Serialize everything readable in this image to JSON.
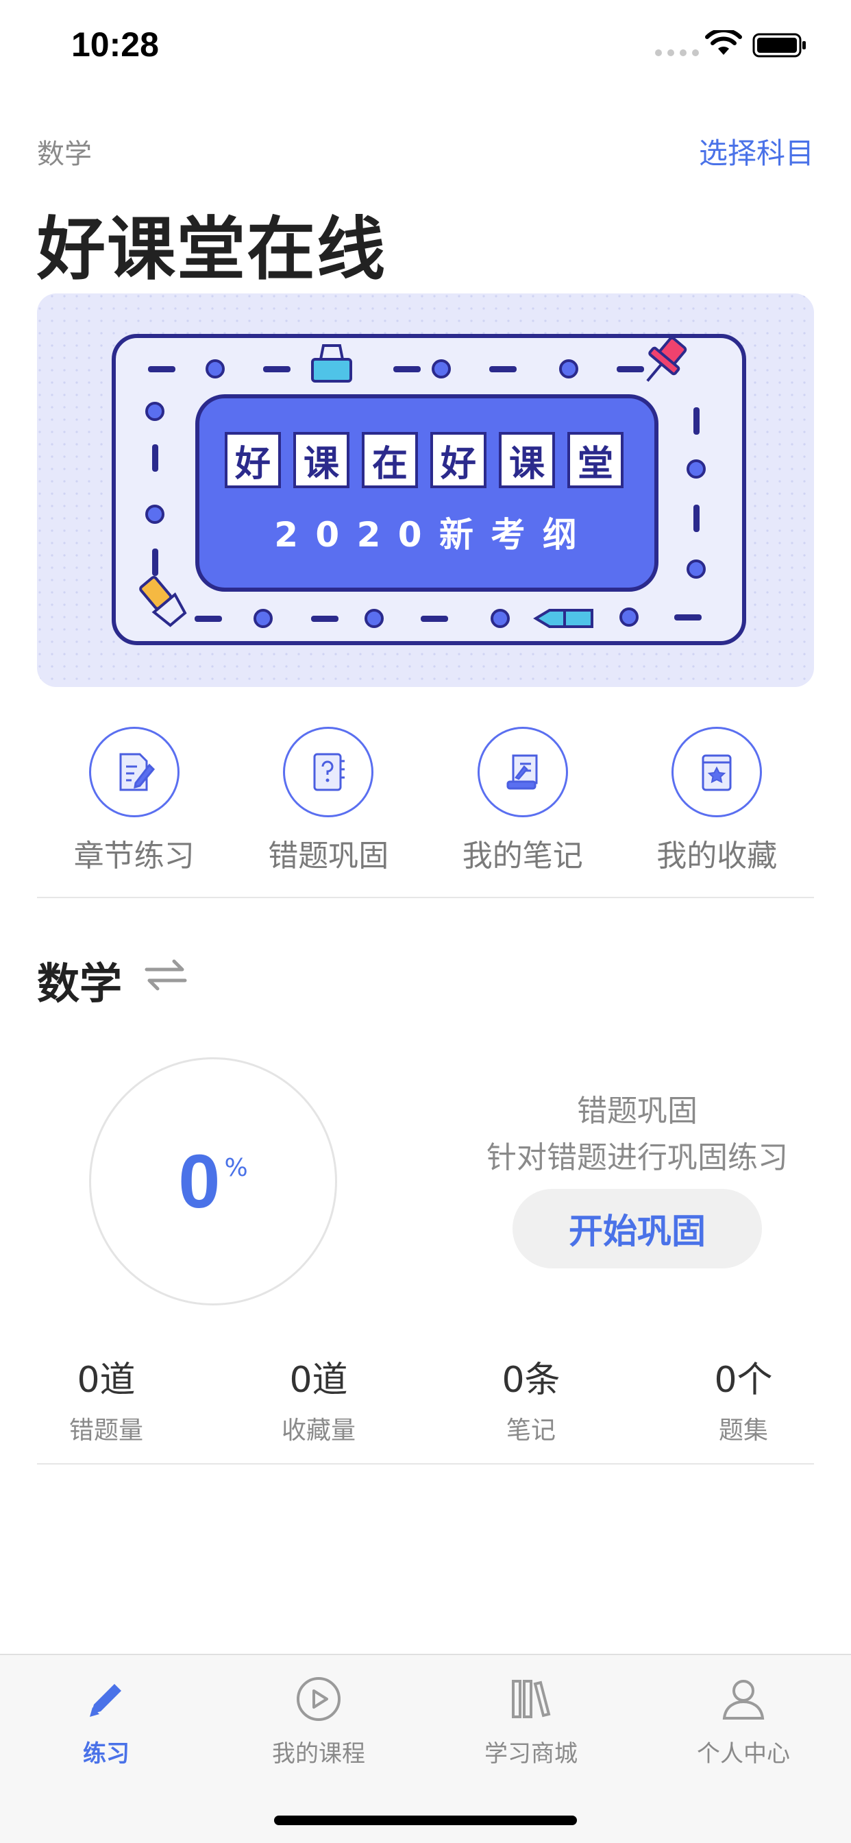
{
  "status": {
    "time": "10:28"
  },
  "header": {
    "subject_small": "数学",
    "select_subject": "选择科目",
    "title": "好课堂在线"
  },
  "banner": {
    "chars": [
      "好",
      "课",
      "在",
      "好",
      "课",
      "堂"
    ],
    "subtitle": "2 0 2 0 新 考 纲"
  },
  "quick_actions": [
    {
      "label": "章节练习",
      "icon": "chapter-practice-icon"
    },
    {
      "label": "错题巩固",
      "icon": "wrong-question-icon"
    },
    {
      "label": "我的笔记",
      "icon": "notes-icon"
    },
    {
      "label": "我的收藏",
      "icon": "favorites-icon"
    }
  ],
  "subject": {
    "title": "数学",
    "progress_value": "0",
    "progress_unit": "%",
    "review_title": "错题巩固",
    "review_desc": "针对错题进行巩固练习",
    "review_button": "开始巩固"
  },
  "stats": [
    {
      "value": "0道",
      "label": "错题量"
    },
    {
      "value": "0道",
      "label": "收藏量"
    },
    {
      "value": "0条",
      "label": "笔记"
    },
    {
      "value": "0个",
      "label": "题集"
    }
  ],
  "tabs": [
    {
      "label": "练习",
      "icon": "pencil-icon",
      "active": true
    },
    {
      "label": "我的课程",
      "icon": "play-icon",
      "active": false
    },
    {
      "label": "学习商城",
      "icon": "books-icon",
      "active": false
    },
    {
      "label": "个人中心",
      "icon": "person-icon",
      "active": false
    }
  ],
  "colors": {
    "accent": "#4a72e8",
    "banner_bg": "#e6e8fb",
    "banner_inner": "#5a6ff0",
    "banner_border": "#2b2a8c"
  }
}
